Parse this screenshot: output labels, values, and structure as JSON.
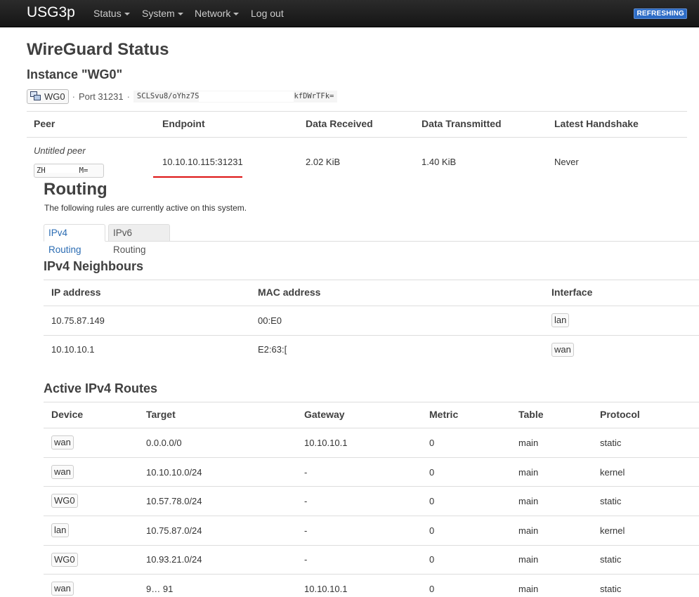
{
  "navbar": {
    "brand": "USG3p",
    "menus": [
      "Status",
      "System",
      "Network",
      "Log out"
    ],
    "badge": "REFRESHING"
  },
  "page": {
    "title": "WireGuard Status",
    "instance_title": "Instance \"WG0\""
  },
  "instance": {
    "iface": "WG0",
    "port": "Port 31231",
    "pubkey_start": "SCLSvu8/oYhz7S",
    "pubkey_end": "kfDWrTFk="
  },
  "peers": {
    "headers": [
      "Peer",
      "Endpoint",
      "Data Received",
      "Data Transmitted",
      "Latest Handshake"
    ],
    "rows": [
      {
        "name": "Untitled peer",
        "key_start": "ZH",
        "key_end": "M=",
        "endpoint": "10.10.10.115:31231",
        "received": "2.02 KiB",
        "transmitted": "1.40 KiB",
        "handshake": "Never"
      }
    ]
  },
  "routing": {
    "title": "Routing",
    "description": "The following rules are currently active on this system.",
    "tabs": [
      "IPv4 Routing",
      "IPv6 Routing"
    ],
    "neighbours": {
      "title": "IPv4 Neighbours",
      "headers": [
        "IP address",
        "MAC address",
        "Interface"
      ],
      "rows": [
        {
          "ip": "10.75.87.149",
          "mac": "00:E0",
          "iface": "lan"
        },
        {
          "ip": "10.10.10.1",
          "mac": "E2:63:[",
          "iface": "wan"
        }
      ]
    },
    "routes": {
      "title": "Active IPv4 Routes",
      "headers": [
        "Device",
        "Target",
        "Gateway",
        "Metric",
        "Table",
        "Protocol"
      ],
      "rows": [
        {
          "device": "wan",
          "target": "0.0.0.0/0",
          "gateway": "10.10.10.1",
          "metric": "0",
          "table": "main",
          "protocol": "static"
        },
        {
          "device": "wan",
          "target": "10.10.10.0/24",
          "gateway": "-",
          "metric": "0",
          "table": "main",
          "protocol": "kernel"
        },
        {
          "device": "WG0",
          "target": "10.57.78.0/24",
          "gateway": "-",
          "metric": "0",
          "table": "main",
          "protocol": "static"
        },
        {
          "device": "lan",
          "target": "10.75.87.0/24",
          "gateway": "-",
          "metric": "0",
          "table": "main",
          "protocol": "kernel"
        },
        {
          "device": "WG0",
          "target": "10.93.21.0/24",
          "gateway": "-",
          "metric": "0",
          "table": "main",
          "protocol": "static"
        },
        {
          "device": "wan",
          "target": "9… 91",
          "gateway": "10.10.10.1",
          "metric": "0",
          "table": "main",
          "protocol": "static"
        }
      ]
    }
  }
}
